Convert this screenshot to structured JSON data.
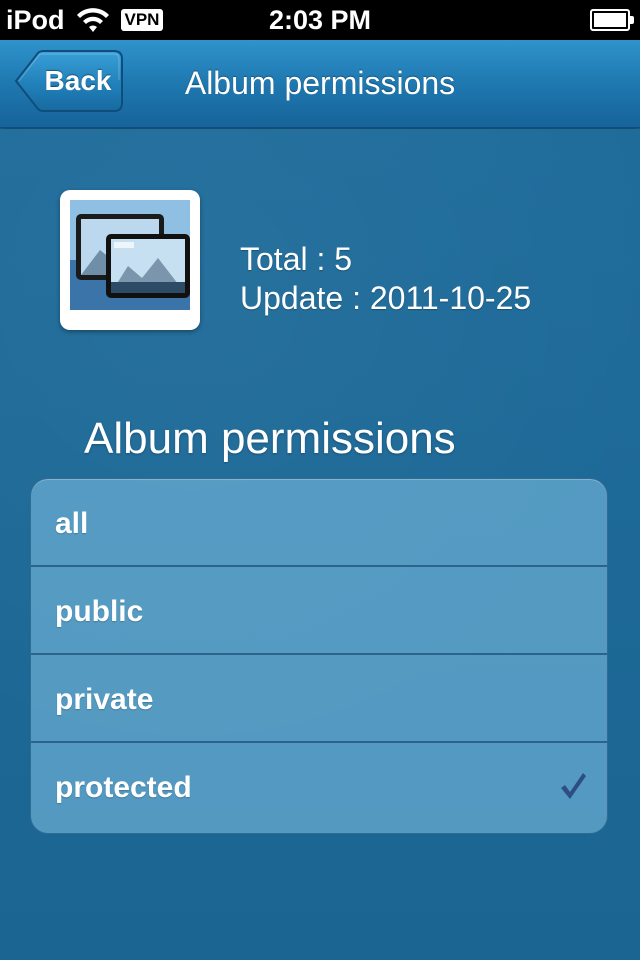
{
  "status_bar": {
    "carrier": "iPod",
    "vpn": "VPN",
    "time": "2:03 PM",
    "icons": [
      "wifi-icon",
      "battery-icon"
    ]
  },
  "nav": {
    "back_label": "Back",
    "title": "Album permissions"
  },
  "album": {
    "total": "Total : 5",
    "update": "Update : 2011-10-25"
  },
  "section_title": "Album permissions",
  "permissions": {
    "items": [
      {
        "label": "all",
        "selected": false
      },
      {
        "label": "public",
        "selected": false
      },
      {
        "label": "private",
        "selected": false
      },
      {
        "label": "protected",
        "selected": true
      }
    ]
  },
  "colors": {
    "background": "#1f6a98",
    "nav_bar": "#1f78b0",
    "checkmark": "#2c4f80"
  }
}
